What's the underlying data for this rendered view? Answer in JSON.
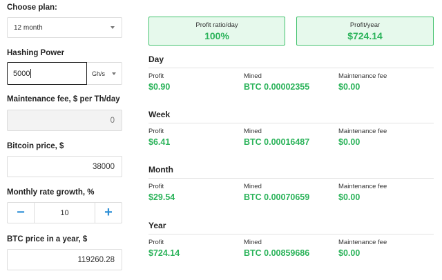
{
  "left": {
    "plan_label": "Choose plan:",
    "plan_value": "12 month",
    "hash_label": "Hashing Power",
    "hash_value": "5000",
    "hash_unit": "Gh/s",
    "fee_label": "Maintenance fee, $ per Th/day",
    "fee_value": "0",
    "btc_label": "Bitcoin price, $",
    "btc_value": "38000",
    "growth_label": "Monthly rate growth, %",
    "growth_minus": "−",
    "growth_value": "10",
    "growth_plus": "+",
    "year_label": "BTC price in a year, $",
    "year_value": "119260.28"
  },
  "summary": {
    "ratio_label": "Profit ratio/day",
    "ratio_value": "100%",
    "year_label": "Profit/year",
    "year_value": "$724.14"
  },
  "col_labels": {
    "profit": "Profit",
    "mined": "Mined",
    "fee": "Maintenance fee"
  },
  "periods": [
    {
      "title": "Day",
      "profit": "$0.90",
      "mined": "BTC 0.00002355",
      "fee": "$0.00"
    },
    {
      "title": "Week",
      "profit": "$6.41",
      "mined": "BTC 0.00016487",
      "fee": "$0.00"
    },
    {
      "title": "Month",
      "profit": "$29.54",
      "mined": "BTC 0.00070659",
      "fee": "$0.00"
    },
    {
      "title": "Year",
      "profit": "$724.14",
      "mined": "BTC 0.00859686",
      "fee": "$0.00"
    }
  ],
  "colors": {
    "accent_green": "#2bb35a",
    "summary_bg": "#e6f9ec",
    "stepper_blue": "#2d8fd6"
  },
  "icons": [
    "chevron-down-icon",
    "minus-icon",
    "plus-icon"
  ]
}
